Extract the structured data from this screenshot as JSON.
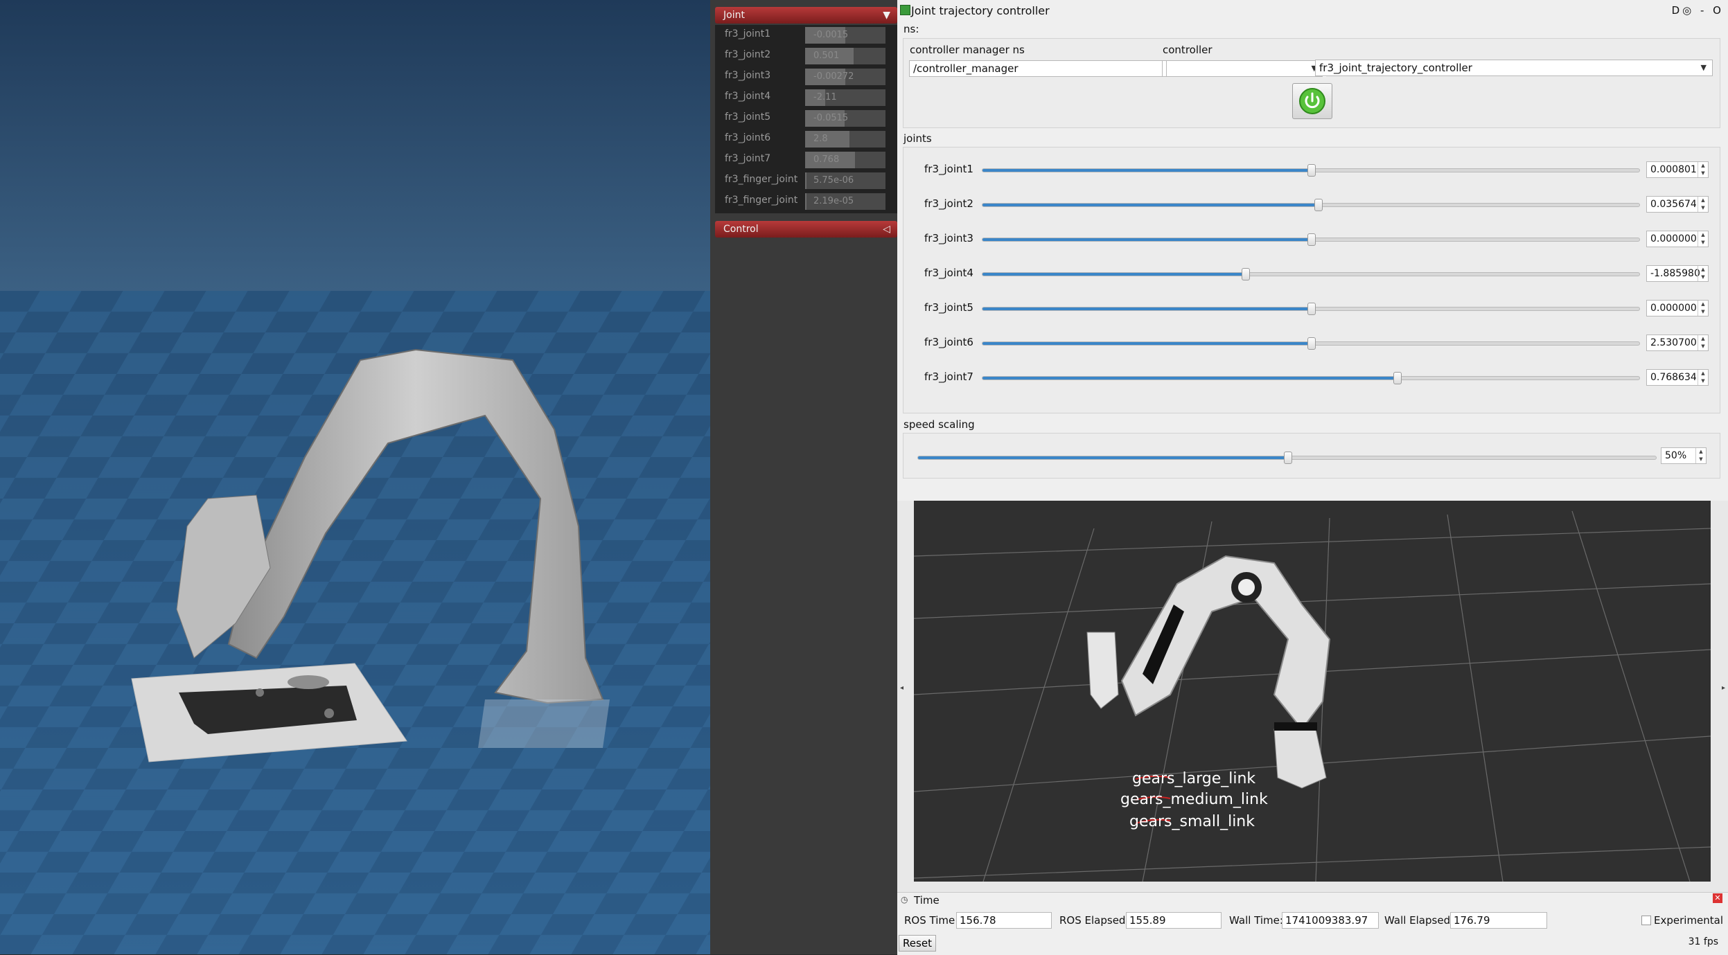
{
  "mujoco": {
    "joint_panel": {
      "title": "Joint",
      "collapse_icon": "triangle-down-icon",
      "items": [
        {
          "label": "fr3_joint1",
          "value": "-0.0015",
          "level": 0.5
        },
        {
          "label": "fr3_joint2",
          "value": "0.501",
          "level": 0.6
        },
        {
          "label": "fr3_joint3",
          "value": "-0.00272",
          "level": 0.5
        },
        {
          "label": "fr3_joint4",
          "value": "-2.11",
          "level": 0.25
        },
        {
          "label": "fr3_joint5",
          "value": "-0.0515",
          "level": 0.49
        },
        {
          "label": "fr3_joint6",
          "value": "2.8",
          "level": 0.55
        },
        {
          "label": "fr3_joint7",
          "value": "0.768",
          "level": 0.62
        },
        {
          "label": "fr3_finger_joint",
          "value": "5.75e-06",
          "level": 0.02
        },
        {
          "label": "fr3_finger_joint",
          "value": "2.19e-05",
          "level": 0.02
        }
      ]
    },
    "control_panel": {
      "title": "Control",
      "collapse_icon": "triangle-left-icon"
    }
  },
  "rqt": {
    "window_title": "Joint trajectory controller",
    "title_controls": "D◎ - O",
    "ns_label": "ns:",
    "controller_manager_label": "controller manager ns",
    "controller_manager_value": "/controller_manager",
    "controller_label": "controller",
    "controller_value": "fr3_joint_trajectory_controller",
    "power_icon": "power-icon",
    "joints_label": "joints",
    "joints": [
      {
        "label": "fr3_joint1",
        "value": "0.000801",
        "position": 0.5
      },
      {
        "label": "fr3_joint2",
        "value": "0.035674",
        "position": 0.51
      },
      {
        "label": "fr3_joint3",
        "value": "0.000000",
        "position": 0.5
      },
      {
        "label": "fr3_joint4",
        "value": "-1.885980",
        "position": 0.4
      },
      {
        "label": "fr3_joint5",
        "value": "0.000000",
        "position": 0.5
      },
      {
        "label": "fr3_joint6",
        "value": "2.530700",
        "position": 0.5
      },
      {
        "label": "fr3_joint7",
        "value": "0.768634",
        "position": 0.63
      }
    ],
    "speed_scaling_label": "speed scaling",
    "speed_scaling_value": "50%",
    "speed_scaling_position": 0.5
  },
  "rviz": {
    "labels": [
      "gears_large_link",
      "gears_medium_link",
      "gears_small_link"
    ]
  },
  "time_panel": {
    "title": "Time",
    "ros_time_label": "ROS Time:",
    "ros_time_value": "156.78",
    "ros_elapsed_label": "ROS Elapsed:",
    "ros_elapsed_value": "155.89",
    "wall_time_label": "Wall Time:",
    "wall_time_value": "1741009383.97",
    "wall_elapsed_label": "Wall Elapsed:",
    "wall_elapsed_value": "176.79",
    "experimental_label": "Experimental",
    "reset_label": "Reset",
    "fps": "31 fps"
  },
  "colors": {
    "mujoco_sky": "#2d4b6e",
    "mujoco_floor": "#2f5f8a",
    "rviz_background": "#303030",
    "slider_fill": "#3b86c8",
    "panel_header": "#9a2a2a"
  }
}
